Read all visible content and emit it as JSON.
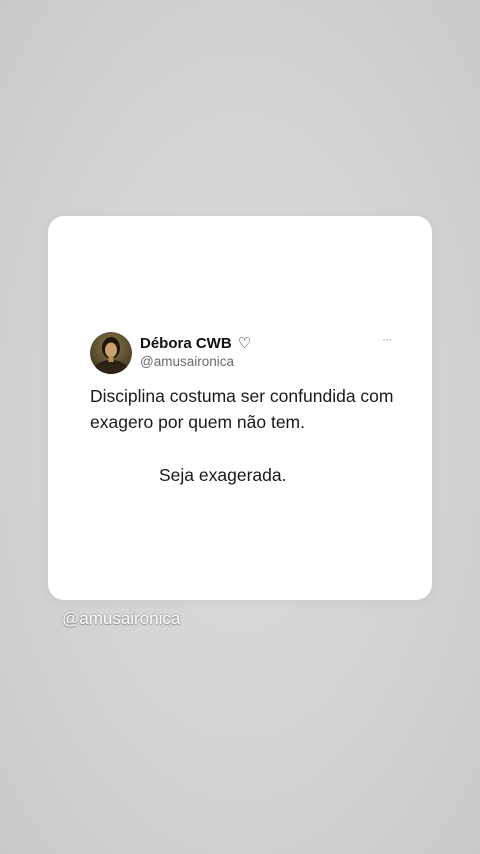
{
  "tweet": {
    "display_name": "Débora CWB",
    "heart": "♡",
    "handle": "@amusaironica",
    "more_label": "···",
    "text_line1": "Disciplina costuma ser confundida com exagero por quem não tem.",
    "text_line2": "Seja exagerada."
  },
  "overlay": {
    "watermark": "@amusaironica"
  },
  "colors": {
    "background": "#d3d3d3",
    "card": "#ffffff",
    "text": "#1a1a1a",
    "handle": "#6b6b6b"
  }
}
